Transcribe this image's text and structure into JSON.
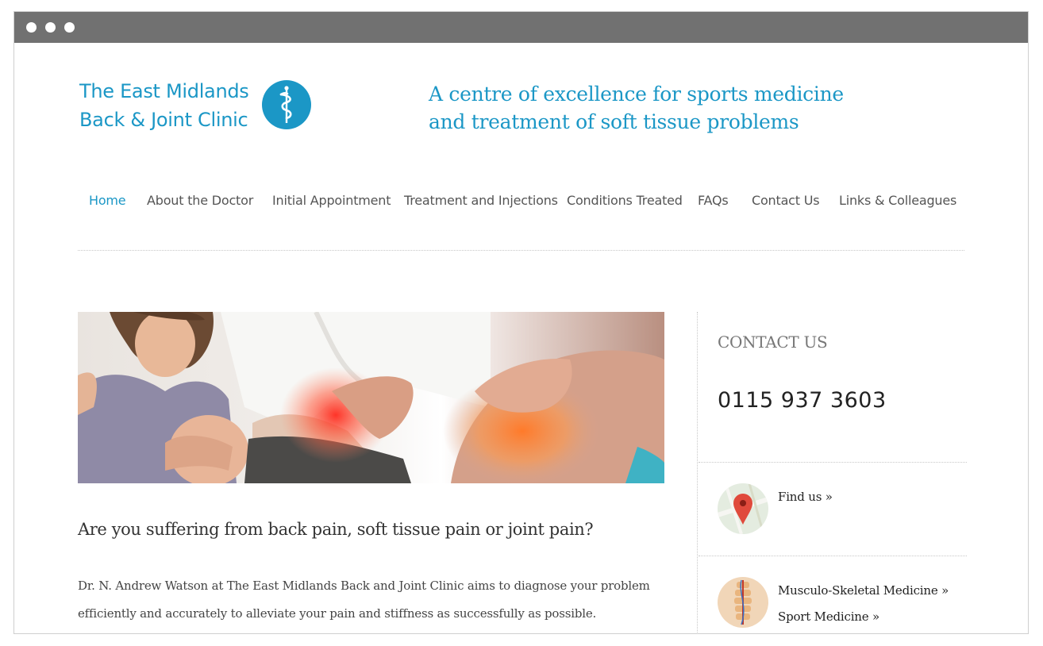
{
  "header": {
    "logo_line1": "The East Midlands",
    "logo_line2": "Back & Joint Clinic",
    "logo_icon": "caduceus-icon",
    "tagline_line1": "A centre of excellence for sports medicine",
    "tagline_line2": "and treatment of soft tissue problems"
  },
  "nav": {
    "items": [
      {
        "label": "Home",
        "active": true
      },
      {
        "label": "About the Doctor"
      },
      {
        "label": "Initial Appointment"
      },
      {
        "label": "Treatment and Injections"
      },
      {
        "label": "Conditions Treated"
      },
      {
        "label": "FAQs"
      },
      {
        "label": "Contact Us"
      },
      {
        "label": "Links & Colleagues"
      }
    ]
  },
  "main": {
    "heading": "Are you suffering from back pain, soft tissue pain or joint pain?",
    "body_line1": "Dr. N. Andrew Watson at The East Midlands Back and Joint Clinic aims to diagnose your problem",
    "body_line2": "efficiently and accurately to alleviate your pain and stiffness as successfully as possible."
  },
  "sidebar": {
    "contact_title": "CONTACT US",
    "phone": "0115 937 3603",
    "find_us_label": "Find us »",
    "find_us_icon": "map-pin-icon",
    "musculo_label": "Musculo-Skeletal Medicine »",
    "sport_label": "Sport Medicine »",
    "spine_icon": "spine-icon"
  },
  "colors": {
    "brand": "#1b97c6",
    "titlebar": "#717171",
    "nav_text": "#555555"
  }
}
